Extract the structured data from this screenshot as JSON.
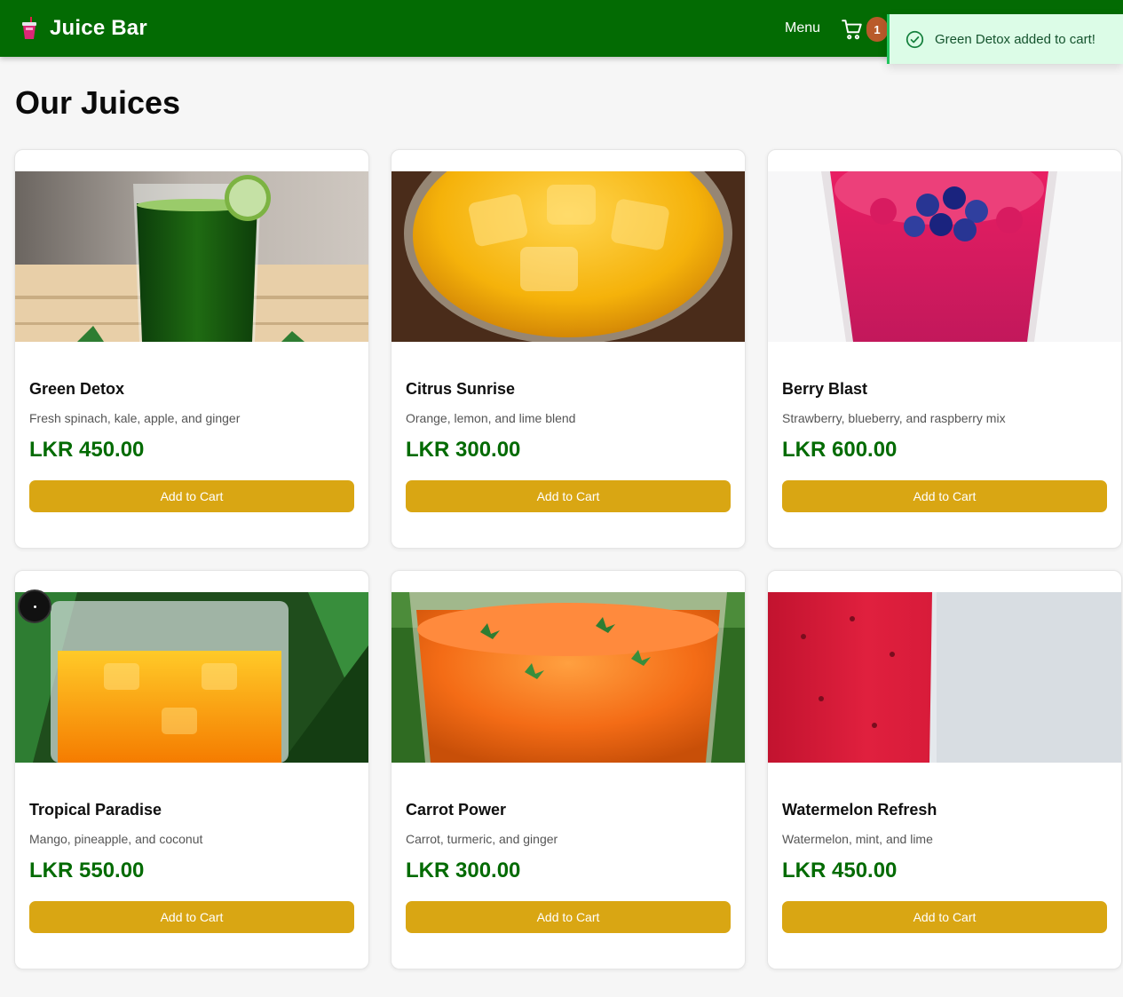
{
  "header": {
    "brand_name": "Juice Bar",
    "brand_icon": "cup-straw-icon",
    "menu_label": "Menu",
    "cart_count": "1",
    "cart_icon": "cart-icon"
  },
  "toast": {
    "message": "Green Detox added to cart!",
    "icon": "check-circle-icon"
  },
  "page": {
    "title": "Our Juices"
  },
  "products": [
    {
      "name": "Green Detox",
      "description": "Fresh spinach, kale, apple, and ginger",
      "price": "LKR 450.00",
      "button_label": "Add to Cart"
    },
    {
      "name": "Citrus Sunrise",
      "description": "Orange, lemon, and lime blend",
      "price": "LKR 300.00",
      "button_label": "Add to Cart"
    },
    {
      "name": "Berry Blast",
      "description": "Strawberry, blueberry, and raspberry mix",
      "price": "LKR 600.00",
      "button_label": "Add to Cart"
    },
    {
      "name": "Tropical Paradise",
      "description": "Mango, pineapple, and coconut",
      "price": "LKR 550.00",
      "button_label": "Add to Cart"
    },
    {
      "name": "Carrot Power",
      "description": "Carrot, turmeric, and ginger",
      "price": "LKR 300.00",
      "button_label": "Add to Cart"
    },
    {
      "name": "Watermelon Refresh",
      "description": "Watermelon, mint, and lime",
      "price": "LKR 450.00",
      "button_label": "Add to Cart"
    }
  ],
  "colors": {
    "header_bg": "#036b03",
    "price": "#036b03",
    "button": "#d9a613",
    "badge": "#b95a2a",
    "toast_bg": "#dcfce7",
    "toast_border": "#22c55e"
  }
}
